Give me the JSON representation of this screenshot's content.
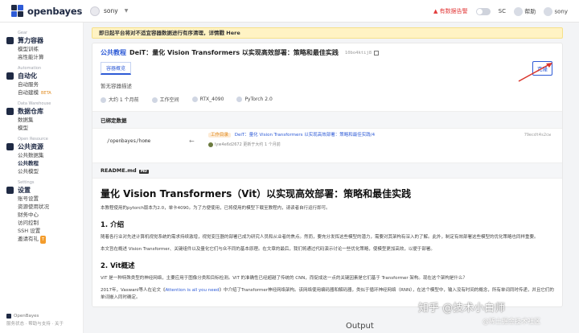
{
  "topbar": {
    "logo": "openbayes",
    "org": "sony",
    "warning": "有数据告警",
    "lang": "SC",
    "help": "帮助",
    "user": "sony"
  },
  "sidebar": {
    "groups": [
      {
        "small": "Gear",
        "head": "算力容器",
        "items": [
          "模型训练",
          "高性能计算"
        ]
      },
      {
        "small": "Automation",
        "head": "自动化",
        "items": [
          "自动服务",
          "自动建模"
        ]
      },
      {
        "small": "Data Warehouse",
        "head": "数据仓库",
        "items": [
          "数据集",
          "模型"
        ]
      },
      {
        "small": "Open Resource",
        "head": "公共资源",
        "items": [
          "公共数据集",
          "公共教程",
          "公共模型"
        ]
      },
      {
        "small": "Settings",
        "head": "设置",
        "items": [
          "账号设置",
          "资源使用状况",
          "财务中心",
          "访问控制",
          "SSH 设置",
          "邀请有礼"
        ]
      }
    ],
    "beta": "BETA",
    "invite_badge": "T",
    "footer_brand": "OpenBayes",
    "footer_links": "服务状态 · 帮助与支持 · 关于"
  },
  "banner": "即日起平台将对不适宜容器数据进行有序清理，详情戳 Here",
  "header": {
    "tag": "公共教程",
    "title": "DeiT：量化 Vision Transformers 以实现高效部署：策略和最佳实践",
    "hash": "10bo4ktij8",
    "clone": "克隆",
    "tab": "容器概览"
  },
  "desc": "暂无容器描述",
  "meta": [
    "大约 1 个月前",
    "工作空间",
    "RTX_4090",
    "PyTorch 2.0"
  ],
  "bound": {
    "title": "已绑定数据",
    "path": "/openbayes/home",
    "label": "工作目录",
    "link": "DeiT：量化 Vision Transformers 以实现高效部署：策略和最佳实践/4",
    "user": "lyw4e6d2672 更新于大约 1 个月前",
    "hash": "79ecdt4s2cw"
  },
  "readme": {
    "bar": "README.md",
    "badge": "MD",
    "h1": "量化 Vision Transformers（Vit）以实现高效部署：策略和最佳实践",
    "p1": "本教程使用的pytorch版本为2.0，单卡4090。为了方便使用，已将使用的模型下载至教程内，请读者自行运行即可。",
    "h2a": "1. 介绍",
    "p2": "随着各行业对先进计算机视觉系统的需求持续激增，视觉变压器的部署已成为研究人员和从业者的焦点。然而，要充分发挥这些模型的潜力，需要对其架构有深入的了解。此外，制定有效部署这些模型的优化策略也同样重要。",
    "p3": "本文旨在概述 Vision Transformer、关键组件以及量化它们与众不同的基本原理。在文章的最后，我们将通过代码演示讨论一些优化策略，使模型更加高效，以便于部署。",
    "h2b": "2. Vit概述",
    "p4": "ViT 是一种特殊类型的神经网络，主要应用于图像分类和目标检测。ViT 的准确性已经超越了传统的 CNN，而促成这一点的关键因素是它们基于 Transformer 架构。现在这个架构是什么？",
    "p5a": "2017年，Vaswani等人在论文《",
    "p5link": "Attention is all you need",
    "p5b": "》中介绍了Transformer神经网络架构。该网络使用编码器和解码器，类似于循环神经网络（RNN），在这个模型中，输入没有时间的概念，所有单词同时传递，并且它们的单词嵌入同时确定。"
  },
  "watermark": "知乎 @技术小白师",
  "watermark2": "@稀土掘金技术社区",
  "output": "Output"
}
